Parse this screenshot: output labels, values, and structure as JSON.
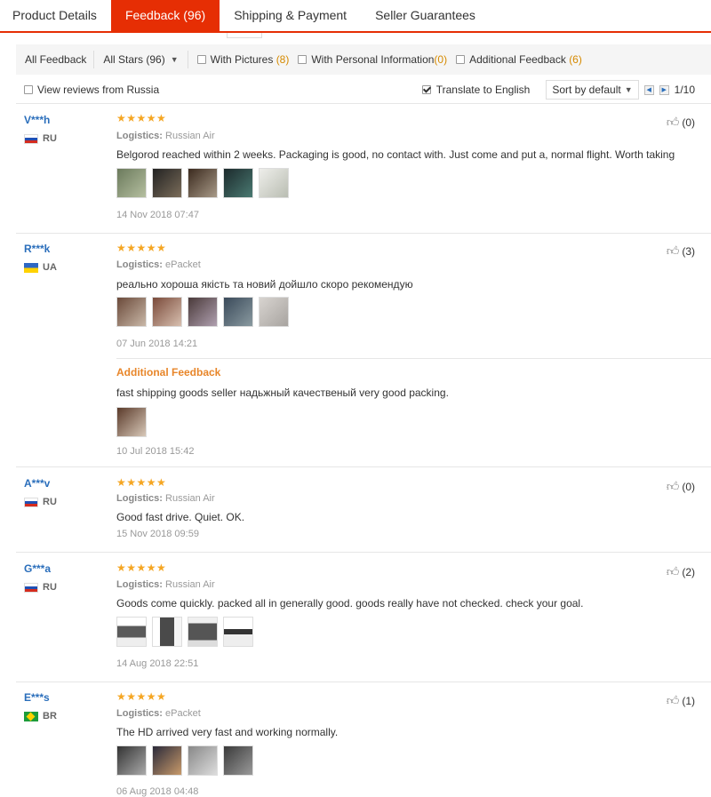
{
  "tabs": [
    "Product Details",
    "Feedback (96)",
    "Shipping & Payment",
    "Seller Guarantees"
  ],
  "filter": {
    "all": "All Feedback",
    "stars": "All Stars (96)",
    "with_pictures": "With Pictures",
    "with_pictures_count": "(8)",
    "with_personal": "With Personal Information",
    "with_personal_count": "(0)",
    "additional": "Additional Feedback",
    "additional_count": "(6)"
  },
  "bar2": {
    "view_russia": "View reviews from Russia",
    "translate": "Translate to English",
    "sort": "Sort by default",
    "page": "1/10"
  },
  "icons": {
    "thumb": "thumbs-up-icon",
    "chevron": "chevron-down-icon"
  },
  "colors": {
    "accent": "#e62e04",
    "link": "#2a6ebb",
    "star": "#f5a623",
    "additional": "#e8862a"
  },
  "reviews": [
    {
      "user": "V***h",
      "country": "RU",
      "stars": "★★★★★",
      "logistics_label": "Logistics:",
      "logistics": "Russian Air",
      "text": "Belgorod reached within 2 weeks. Packaging is good, no contact with. Just come and put a, normal flight. Worth taking",
      "date": "14 Nov 2018 07:47",
      "helpful": "(0)"
    },
    {
      "user": "R***k",
      "country": "UA",
      "stars": "★★★★★",
      "logistics_label": "Logistics:",
      "logistics": "ePacket",
      "text": "реально хороша якість та новий дойшло скоро рекомендую",
      "date": "07 Jun 2018 14:21",
      "helpful": "(3)",
      "additional_title": "Additional Feedback",
      "additional_text": "fast shipping goods seller надьжный качественый very good packing.",
      "additional_date": "10 Jul 2018 15:42"
    },
    {
      "user": "A***v",
      "country": "RU",
      "stars": "★★★★★",
      "logistics_label": "Logistics:",
      "logistics": "Russian Air",
      "text": "Good fast drive. Quiet. OK.",
      "date": "15 Nov 2018 09:59",
      "helpful": "(0)"
    },
    {
      "user": "G***a",
      "country": "RU",
      "stars": "★★★★★",
      "logistics_label": "Logistics:",
      "logistics": "Russian Air",
      "text": "Goods come quickly. packed all in generally good. goods really have not checked. check your goal.",
      "date": "14 Aug 2018 22:51",
      "helpful": "(2)"
    },
    {
      "user": "E***s",
      "country": "BR",
      "stars": "★★★★★",
      "logistics_label": "Logistics:",
      "logistics": "ePacket",
      "text": "The HD arrived very fast and working normally.",
      "date": "06 Aug 2018 04:48",
      "helpful": "(1)"
    }
  ]
}
